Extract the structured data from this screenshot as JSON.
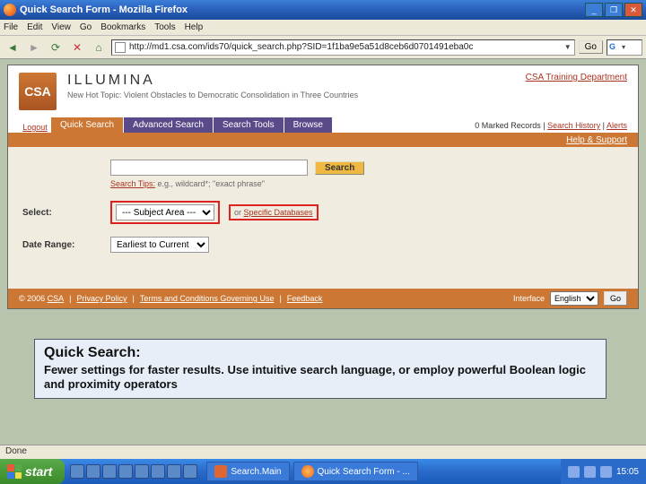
{
  "window": {
    "title": "Quick Search Form - Mozilla Firefox"
  },
  "firefox": {
    "menu": [
      "File",
      "Edit",
      "View",
      "Go",
      "Bookmarks",
      "Tools",
      "Help"
    ],
    "url": "http://md1.csa.com/ids70/quick_search.php?SID=1f1ba9e5a51d8ceb6d0701491eba0c",
    "go": "Go",
    "status": "Done"
  },
  "header": {
    "logo": "CSA",
    "brand": "ILLUMINA",
    "hot_topic": "New Hot Topic: Violent Obstacles to Democratic Consolidation in Three Countries",
    "training_link": "CSA Training Department"
  },
  "tabs": {
    "logout": "Logout",
    "quick": "Quick Search",
    "advanced": "Advanced Search",
    "tools": "Search Tools",
    "browse": "Browse",
    "marked": "0 Marked Records",
    "history": "Search History",
    "alerts": "Alerts"
  },
  "bar": {
    "help": "Help & Support"
  },
  "form": {
    "search_btn": "Search",
    "tips_link": "Search Tips:",
    "tips_text": " e.g., wildcard*; \"exact phrase\"",
    "select_label": "Select:",
    "subject_value": "--- Subject Area ---",
    "or": "or ",
    "specific": "Specific Databases",
    "date_label": "Date Range:",
    "date_value": "Earliest to Current"
  },
  "footer": {
    "copyright": "© 2006 ",
    "csa": "CSA",
    "privacy": "Privacy Policy",
    "terms": "Terms and Conditions Governing Use",
    "feedback": "Feedback",
    "interface": "Interface",
    "lang": "English",
    "go": "Go"
  },
  "annotation": {
    "title": "Quick Search:",
    "body": "Fewer settings for faster results. Use intuitive search language, or employ powerful Boolean logic and proximity operators"
  },
  "taskbar": {
    "start": "start",
    "task1": "Search.Main",
    "task2": "Quick Search Form - ...",
    "time": "15:05"
  }
}
